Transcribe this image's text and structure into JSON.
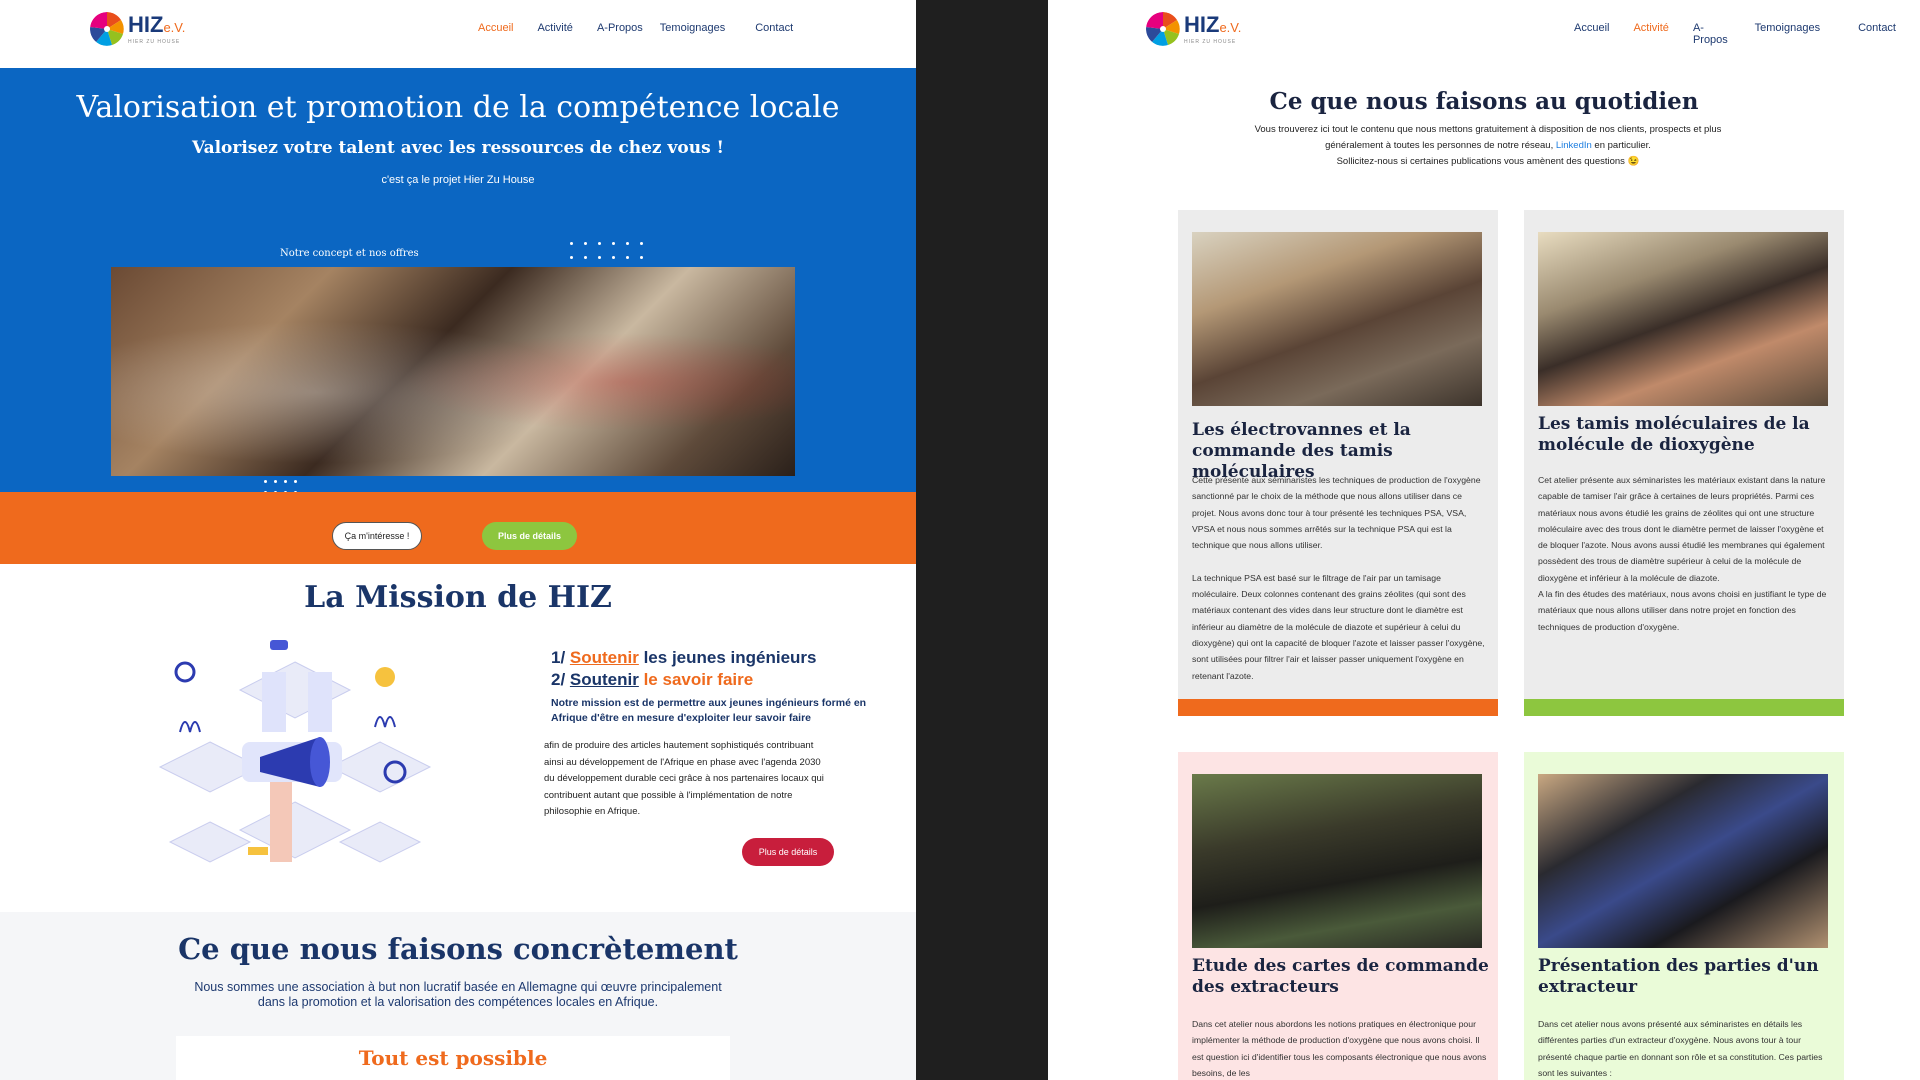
{
  "left": {
    "logo": {
      "name": "HIZ",
      "suffix": "e.V.",
      "tagline": "HIER ZU HOUSE"
    },
    "nav": [
      {
        "label": "Accueil",
        "active": true
      },
      {
        "label": "Activité",
        "active": false
      },
      {
        "label": "A-Propos",
        "active": false
      },
      {
        "label": "Temoignages",
        "active": false
      },
      {
        "label": "Contact",
        "active": false
      }
    ],
    "hero": {
      "title": "Valorisation et promotion de la compétence locale",
      "subtitle": "Valorisez votre talent avec les ressources de chez vous !",
      "tagline": "c'est ça le projet Hier Zu House",
      "concept_label": "Notre concept et nos offres"
    },
    "buttons": {
      "interest": "Ça m'intéresse !",
      "details": "Plus de détails",
      "mission_details": "Plus de détails"
    },
    "mission": {
      "title": "La Mission de HIZ",
      "line1_prefix": "1/ ",
      "line1_link": "Soutenir",
      "line1_rest": " les jeunes ingénieurs",
      "line2_prefix": "2/ ",
      "line2_link": "Soutenir",
      "line2_rest": " le savoir faire",
      "bold_text": "Notre mission est de permettre aux jeunes ingénieurs formé en Afrique d'être en mesure d'exploiter leur savoir faire",
      "body": "afin de produire des articles hautement sophistiqués contribuant ainsi au développement de l'Afrique en phase avec l'agenda 2030 du développement durable ceci grâce à nos partenaires locaux qui contribuent autant que possible à l'implémentation de notre philosophie en Afrique."
    },
    "concrete": {
      "title": "Ce que nous faisons concrètement",
      "text": "Nous sommes une association à but non lucratif basée en Allemagne qui œuvre principalement dans la promotion et la valorisation des compétences locales en Afrique.",
      "box_title": "Tout est possible"
    }
  },
  "right": {
    "logo": {
      "name": "HIZ",
      "suffix": "e.V.",
      "tagline": "HIER ZU HOUSE"
    },
    "nav": [
      {
        "label": "Accueil",
        "active": false
      },
      {
        "label": "Activité",
        "active": true
      },
      {
        "label": "A-Propos",
        "active": false
      },
      {
        "label": "Temoignages",
        "active": false
      },
      {
        "label": "Contact",
        "active": false
      }
    ],
    "title": "Ce que nous faisons au quotidien",
    "intro_1": "Vous trouverez ici tout le contenu que nous mettons gratuitement à disposition de nos clients, prospects et plus généralement à toutes les personnes de notre réseau, ",
    "intro_link": "LinkedIn",
    "intro_2": " en particulier.",
    "intro_3": "Sollicitez-nous si certaines publications vous amènent des questions 😉",
    "cards": [
      {
        "title": "Les électrovannes et la commande des tamis moléculaires",
        "text": "Cette présente aux séminaristes les techniques de production de l'oxygène sanctionné par le choix de la méthode que nous allons utiliser dans ce projet. Nous avons donc tour à tour présenté les techniques PSA, VSA, VPSA et nous nous sommes arrêtés sur la technique PSA qui est la technique que nous allons utiliser.\n\nLa technique PSA est basé sur le filtrage de l'air par un tamisage moléculaire. Deux colonnes contenant des grains zéolites (qui sont des matériaux contenant des vides dans leur structure dont le diamètre est inférieur au diamètre de la molécule de diazote et supérieur à celui du dioxygène) qui ont la capacité de bloquer l'azote et laisser passer l'oxygène, sont utilisées pour filtrer l'air et laisser passer uniquement l'oxygène en retenant l'azote.",
        "bg": "#ececec",
        "bar": "#ef6a1d"
      },
      {
        "title": "Les tamis moléculaires de la molécule de dioxygène",
        "text": "Cet atelier présente aux séminaristes les matériaux existant dans la nature capable de tamiser l'air grâce à certaines de leurs propriétés. Parmi ces matériaux nous avons étudié les grains de zéolites qui ont une structure moléculaire avec des trous dont le diamètre permet de laisser l'oxygène et de bloquer l'azote. Nous avons aussi étudié les membranes qui également possèdent des trous de diamètre supérieur à celui de la molécule de dioxygène et inférieur à la molécule de diazote.\nA la fin des études des matériaux, nous avons choisi en justifiant le type de matériaux que nous allons utiliser dans notre projet en fonction des techniques de production d'oxygène.",
        "bg": "#ececec",
        "bar": "#8dc63f"
      },
      {
        "title": "Etude des cartes de commande des extracteurs",
        "text": "Dans cet atelier nous abordons les notions pratiques en électronique pour implémenter la méthode de production d'oxygène que nous avons choisi. Il est question ici d'identifier tous les composants électronique que nous avons besoins, de les",
        "bg": "#fde4e4",
        "bar": ""
      },
      {
        "title": "Présentation des parties d'un extracteur",
        "text": "Dans cet atelier nous avons présenté aux séminaristes en détails les différentes parties d'un extracteur d'oxygène. Nous avons tour à tour présenté chaque partie en donnant son rôle et sa constitution. Ces parties sont les suivantes :",
        "bg": "#eafbd8",
        "bar": ""
      }
    ]
  }
}
